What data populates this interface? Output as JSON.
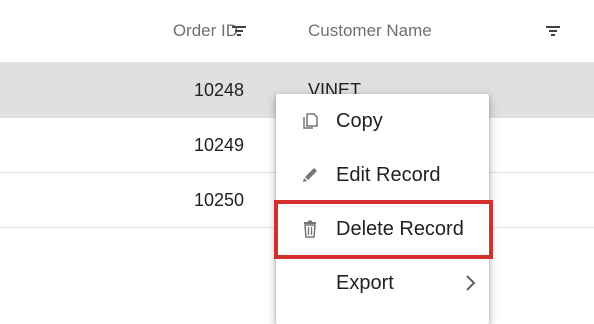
{
  "columns": {
    "order_id": "Order ID",
    "customer_name": "Customer Name"
  },
  "rows": [
    {
      "order_id": "10248",
      "customer": "VINET",
      "selected": true
    },
    {
      "order_id": "10249",
      "customer": "",
      "selected": false
    },
    {
      "order_id": "10250",
      "customer": "",
      "selected": false
    }
  ],
  "context_menu": {
    "items": [
      {
        "label": "Copy",
        "icon": "copy-icon"
      },
      {
        "label": "Edit Record",
        "icon": "edit-icon"
      },
      {
        "label": "Delete Record",
        "icon": "delete-icon",
        "highlighted": true
      },
      {
        "label": "Export",
        "icon": "",
        "has_submenu": true
      }
    ]
  },
  "colors": {
    "selected_row": "#e0e0e0",
    "highlight_border": "#d32f2f",
    "header_text": "#6f6f6f",
    "icon_gray": "#757575"
  }
}
